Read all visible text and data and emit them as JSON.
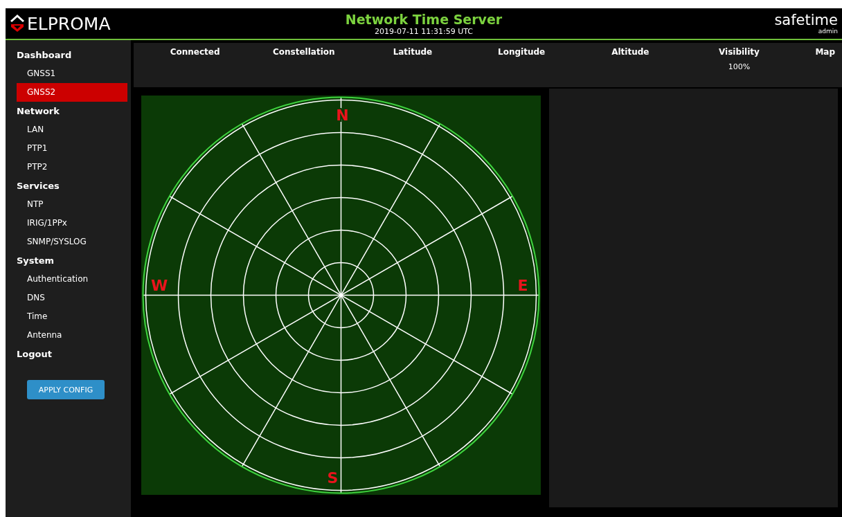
{
  "header": {
    "logo": "ELPROMA",
    "title": "Network Time Server",
    "datetime": "2019-07-11 11:31:59 UTC",
    "brand": "safetime",
    "user": "admin"
  },
  "sidebar": {
    "sections": [
      {
        "label": "Dashboard",
        "children": [
          {
            "label": "GNSS1",
            "selected": false
          },
          {
            "label": "GNSS2",
            "selected": true
          }
        ]
      },
      {
        "label": "Network",
        "children": [
          {
            "label": "LAN",
            "selected": false
          },
          {
            "label": "PTP1",
            "selected": false
          },
          {
            "label": "PTP2",
            "selected": false
          }
        ]
      },
      {
        "label": "Services",
        "children": [
          {
            "label": "NTP",
            "selected": false
          },
          {
            "label": "IRIG/1PPx",
            "selected": false
          },
          {
            "label": "SNMP/SYSLOG",
            "selected": false
          }
        ]
      },
      {
        "label": "System",
        "children": [
          {
            "label": "Authentication",
            "selected": false
          },
          {
            "label": "DNS",
            "selected": false
          },
          {
            "label": "Time",
            "selected": false
          },
          {
            "label": "Antenna",
            "selected": false
          }
        ]
      },
      {
        "label": "Logout"
      }
    ],
    "button": "APPLY CONFIG"
  },
  "table": {
    "columns": [
      {
        "label": "Connected"
      },
      {
        "label": "Constellation"
      },
      {
        "label": "Latitude"
      },
      {
        "label": "Longitude"
      },
      {
        "label": "Altitude"
      },
      {
        "label": "Visibility",
        "value": "100%"
      },
      {
        "label": "Map"
      }
    ]
  },
  "skyplot": {
    "north": "N",
    "east": "E",
    "south": "S",
    "west": "W"
  }
}
